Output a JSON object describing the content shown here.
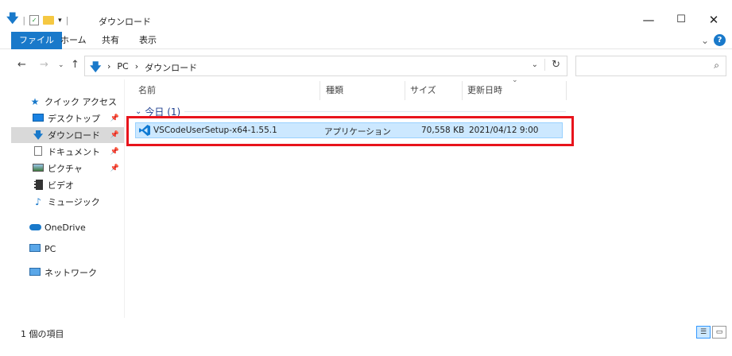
{
  "window": {
    "title": "ダウンロード",
    "minimize_glyph": "—",
    "maximize_glyph": "☐",
    "close_glyph": "✕"
  },
  "ribbon": {
    "tabs": [
      "ファイル",
      "ホーム",
      "共有",
      "表示"
    ],
    "expand_glyph": "⌄",
    "help_glyph": "?"
  },
  "address": {
    "crumbs": [
      "PC",
      "ダウンロード"
    ],
    "separator": "›",
    "search_placeholder": ""
  },
  "nav": {
    "quick_access": "クイック アクセス",
    "items": [
      {
        "label": "デスクトップ",
        "icon": "desktop-icon",
        "pinned": true
      },
      {
        "label": "ダウンロード",
        "icon": "download-icon",
        "pinned": true,
        "selected": true
      },
      {
        "label": "ドキュメント",
        "icon": "document-icon",
        "pinned": true
      },
      {
        "label": "ピクチャ",
        "icon": "pictures-icon",
        "pinned": true
      },
      {
        "label": "ビデオ",
        "icon": "video-icon",
        "pinned": false
      },
      {
        "label": "ミュージック",
        "icon": "music-icon",
        "pinned": false
      }
    ],
    "onedrive": "OneDrive",
    "pc": "PC",
    "network": "ネットワーク"
  },
  "columns": {
    "name": "名前",
    "type": "種類",
    "size": "サイズ",
    "modified": "更新日時"
  },
  "group": {
    "label": "今日 (1)"
  },
  "files": [
    {
      "name": "VSCodeUserSetup-x64-1.55.1",
      "type": "アプリケーション",
      "size": "70,558 KB",
      "modified": "2021/04/12 9:00",
      "icon": "vscode-icon"
    }
  ],
  "status": {
    "count_text": "1 個の項目"
  },
  "colors": {
    "accent": "#1979ca",
    "selection": "#cce8ff",
    "highlight_border": "#e8141c"
  }
}
